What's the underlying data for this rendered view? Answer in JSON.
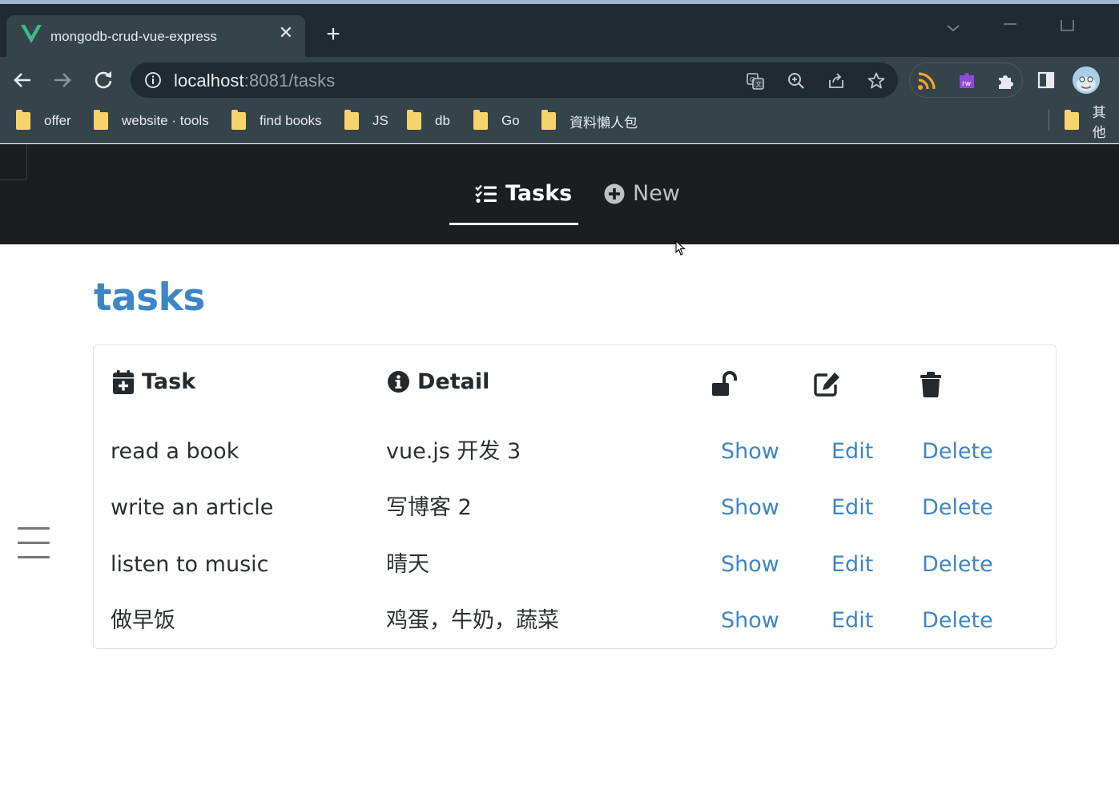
{
  "browser": {
    "tab_title": "mongodb-crud-vue-express",
    "url_host": "localhost",
    "url_rest": ":8081/tasks",
    "bookmarks": [
      "offer",
      "website · tools",
      "find books",
      "JS",
      "db",
      "Go",
      "資料懶人包",
      "其他"
    ]
  },
  "nav": {
    "tasks_label": "Tasks",
    "new_label": "New"
  },
  "page": {
    "title": "tasks"
  },
  "table": {
    "headers": {
      "task": "Task",
      "detail": "Detail"
    },
    "action_labels": {
      "show": "Show",
      "edit": "Edit",
      "delete": "Delete"
    },
    "rows": [
      {
        "task": "read a book",
        "detail": "vue.js 开发 3"
      },
      {
        "task": "write an article",
        "detail": "写博客 2"
      },
      {
        "task": "listen to music",
        "detail": "晴天"
      },
      {
        "task": "做早饭",
        "detail": "鸡蛋，牛奶，蔬菜"
      }
    ]
  },
  "colors": {
    "accent": "#3d86c6",
    "navbar": "#1b1d1f",
    "chrome": "#35434b"
  }
}
